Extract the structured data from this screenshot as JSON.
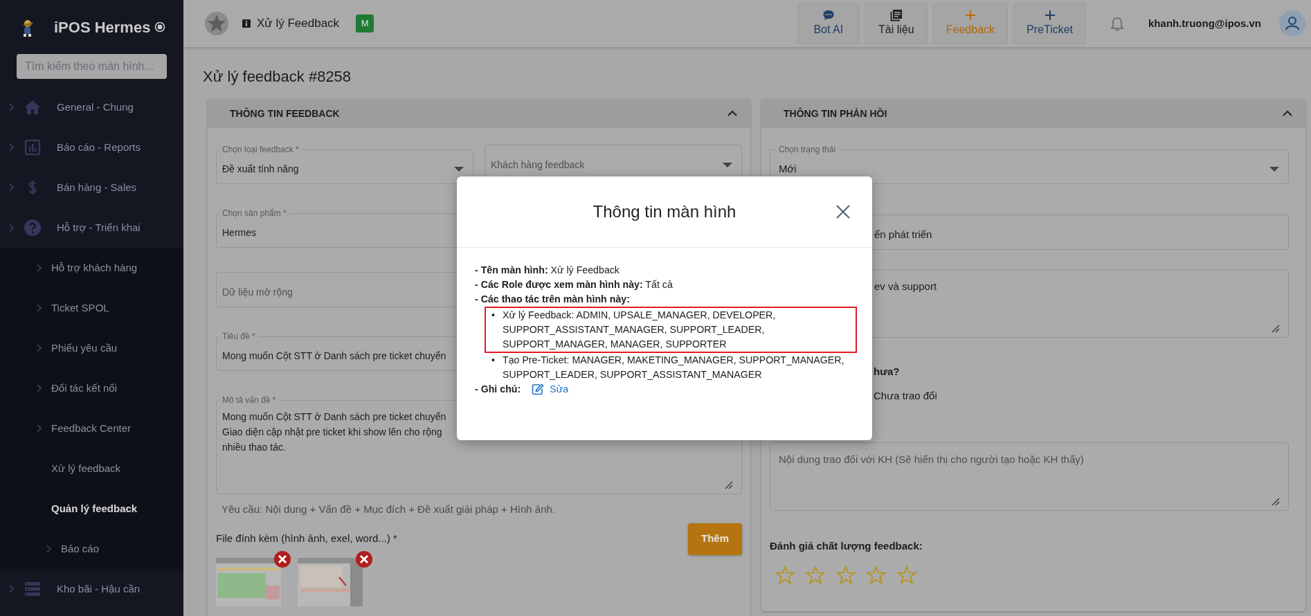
{
  "sidebar": {
    "brand": "iPOS Hermes",
    "search": {
      "placeholder": "Tìm kiếm theo màn hình..."
    },
    "items": [
      {
        "label": "General - Chung",
        "expandable": true,
        "selected": false
      },
      {
        "label": "Báo cáo - Reports",
        "expandable": true,
        "selected": false
      },
      {
        "label": "Bán hàng - Sales",
        "expandable": true,
        "selected": false
      },
      {
        "label": "Hỗ trợ - Triển khai",
        "expandable": true,
        "selected": false,
        "children": [
          {
            "label": "Hỗ trợ khách hàng",
            "expandable": true,
            "selected": false
          },
          {
            "label": "Ticket SPOL",
            "expandable": true,
            "selected": false
          },
          {
            "label": "Phiếu yêu cầu",
            "expandable": true,
            "selected": false
          },
          {
            "label": "Đối tác kết nối",
            "expandable": true,
            "selected": false
          },
          {
            "label": "Feedback Center",
            "expandable": true,
            "selected": false
          },
          {
            "label": "Xử lý feedback",
            "expandable": false,
            "selected": false
          },
          {
            "label": "Quản lý feedback",
            "expandable": false,
            "selected": true,
            "children": [
              {
                "label": "Báo cáo",
                "expandable": true,
                "selected": false
              }
            ]
          }
        ]
      },
      {
        "label": "Kho bãi - Hậu cần",
        "expandable": true,
        "selected": false
      }
    ]
  },
  "topbar": {
    "title": "Xử lý Feedback",
    "badge": "M",
    "actions": [
      {
        "label": "Bot AI",
        "color": "#1f3f66"
      },
      {
        "label": "Tài liệu",
        "color": "#1e1e1e"
      },
      {
        "label": "Feedback",
        "color": "#b06a10"
      },
      {
        "label": "PreTicket",
        "color": "#1f3f66"
      }
    ],
    "user": "khanh.truong@ipos.vn"
  },
  "page_title": "Xử lý feedback #8258",
  "feedback_card": {
    "title": "THÔNG TIN FEEDBACK",
    "expanded": true,
    "fields": [
      {
        "kind": "select",
        "label": "Chọn loại feedback *",
        "value": "Đề xuất tính năng"
      },
      {
        "kind": "select",
        "placeholder": "Khách hàng feedback"
      },
      {
        "kind": "input",
        "label": "Chọn sản phẩm *",
        "value": "Hermes"
      },
      {
        "kind": "input",
        "placeholder": "Dữ liệu mở rộng"
      },
      {
        "kind": "input",
        "label": "Tiêu đề *",
        "value": "Mong muốn Cột STT ở Danh sách pre ticket chuyển"
      },
      {
        "kind": "textarea",
        "label": "Mô tả vấn đề *",
        "value": "Mong muốn Cột STT ở Danh sách pre ticket chuyển\nGiao diện cập nhật pre ticket khi show lên cho rộng\nnhiều thao tác."
      }
    ],
    "hint": "Yêu cầu: Nội dung + Vấn đề + Mục đích + Đề xuất giải pháp + Hình ảnh.",
    "attachments": {
      "label": "File đính kèm (hình ảnh, exel, word...) *",
      "button": "Thêm"
    }
  },
  "response_card": {
    "title": "THÔNG TIN PHẢN HỒI",
    "expanded": true,
    "items": [
      {
        "kind": "select",
        "label": "Chọn trạng thái",
        "value": "Mới"
      },
      {
        "kind": "input",
        "value": "ến phát triển"
      },
      {
        "kind": "textarea",
        "value": "ev và support"
      },
      {
        "kind": "question",
        "text": "hưa?"
      },
      {
        "kind": "option",
        "text": "Chưa trao đổi"
      },
      {
        "kind": "textarea",
        "placeholder": "Nội dung trao đổi với KH (Sẽ hiển thị cho người tạo hoặc KH thấy)"
      },
      {
        "kind": "rating",
        "label": "Đánh giá chất lượng feedback:",
        "stars": 0
      }
    ]
  },
  "modal": {
    "title": "Thông tin màn hình",
    "lines": [
      {
        "label": "- Tên màn hình:",
        "value": "Xử lý Feedback"
      },
      {
        "label": "- Các Role được xem màn hình này:",
        "value": "Tất cả"
      },
      {
        "label": "- Các thao tác trên màn hình này:",
        "items": [
          {
            "bullet": "•",
            "text": "Xử lý Feedback: ADMIN, UPSALE_MANAGER, DEVELOPER, SUPPORT_ASSISTANT_MANAGER, SUPPORT_LEADER, SUPPORT_MANAGER, MANAGER, SUPPORTER",
            "highlighted": true
          },
          {
            "bullet": "•",
            "text": "Tạo Pre-Ticket: MANAGER, MAKETING_MANAGER, SUPPORT_MANAGER, SUPPORT_LEADER, SUPPORT_ASSISTANT_MANAGER",
            "highlighted": false
          }
        ]
      },
      {
        "label": "- Ghi chú:",
        "link": "Sửa"
      }
    ]
  }
}
